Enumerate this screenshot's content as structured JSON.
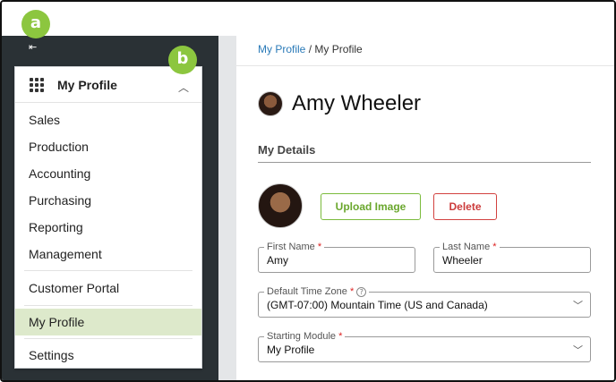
{
  "markers": {
    "a": "a",
    "b": "b"
  },
  "sidebar": {
    "collapse_icon": "⇤",
    "menu": {
      "title": "My Profile",
      "items": [
        {
          "label": "Sales"
        },
        {
          "label": "Production"
        },
        {
          "label": "Accounting"
        },
        {
          "label": "Purchasing"
        },
        {
          "label": "Reporting"
        },
        {
          "label": "Management"
        }
      ],
      "customer_portal": "Customer Portal",
      "my_profile": "My Profile",
      "settings": "Settings"
    }
  },
  "breadcrumb": {
    "link": "My Profile",
    "separator": "/",
    "current": "My Profile"
  },
  "profile": {
    "name": "Amy Wheeler",
    "section_title": "My Details",
    "upload_label": "Upload Image",
    "delete_label": "Delete"
  },
  "form": {
    "first_name": {
      "label": "First Name",
      "required": "*",
      "value": "Amy"
    },
    "last_name": {
      "label": "Last Name",
      "required": "*",
      "value": "Wheeler"
    },
    "time_zone": {
      "label": "Default Time Zone",
      "required": "*",
      "help": "?",
      "value": "(GMT-07:00) Mountain Time (US and Canada)"
    },
    "starting_module": {
      "label": "Starting Module",
      "required": "*",
      "value": "My Profile"
    }
  },
  "colors": {
    "accent_green": "#8cc63f",
    "active_row": "#dde9cb",
    "link_blue": "#2a7ab8",
    "delete_red": "#cc3b3b",
    "sidebar_dark": "#2a3135"
  }
}
